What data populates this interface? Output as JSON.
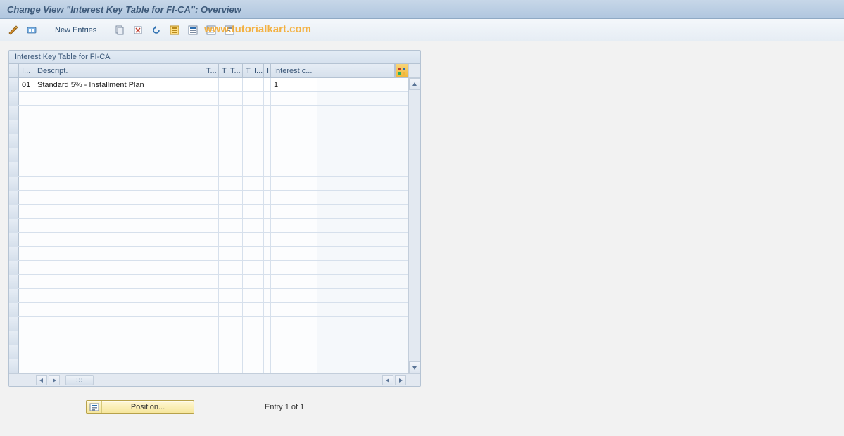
{
  "title": "Change View \"Interest Key Table for FI-CA\": Overview",
  "toolbar": {
    "new_entries_label": "New Entries"
  },
  "watermark": "www.tutorialkart.com",
  "table": {
    "title": "Interest Key Table for FI-CA",
    "columns": {
      "key": "I...",
      "desc": "Descript.",
      "t1": "T...",
      "t2": "T",
      "t3": "T...",
      "t4": "T",
      "i1": "I...",
      "i2": "I.",
      "intc": "Interest c..."
    },
    "rows": [
      {
        "key": "01",
        "desc": "Standard 5% - Installment Plan",
        "t1": "",
        "t2": "",
        "t3": "",
        "t4": "",
        "i1": "",
        "i2": "",
        "intc": "1"
      }
    ],
    "empty_row_count": 20
  },
  "footer": {
    "position_label": "Position...",
    "entry_count": "Entry 1 of 1"
  }
}
